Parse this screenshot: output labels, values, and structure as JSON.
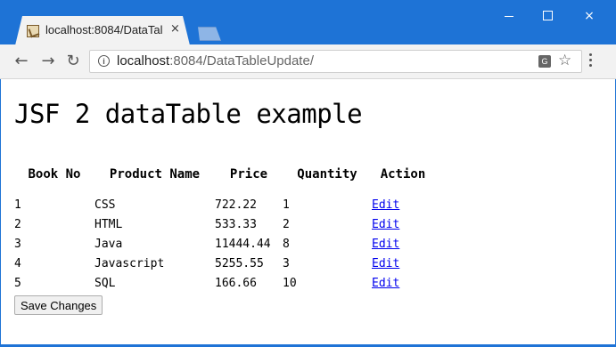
{
  "browser": {
    "tab_title": "localhost:8084/DataTal",
    "url_host": "localhost",
    "url_rest": ":8084/DataTableUpdate/",
    "close_glyph": "×",
    "back_glyph": "←",
    "forward_glyph": "→",
    "reload_glyph": "↻",
    "star_glyph": "☆",
    "info_glyph": "i",
    "translate_glyph": "G"
  },
  "page": {
    "heading": "JSF 2 dataTable example",
    "table": {
      "columns": [
        "Book No",
        "Product Name",
        "Price",
        "Quantity",
        "Action"
      ],
      "rows": [
        {
          "no": "1",
          "name": "CSS",
          "price": "722.22",
          "qty": "1",
          "action": "Edit"
        },
        {
          "no": "2",
          "name": "HTML",
          "price": "533.33",
          "qty": "2",
          "action": "Edit"
        },
        {
          "no": "3",
          "name": "Java",
          "price": "11444.44",
          "qty": "8",
          "action": "Edit"
        },
        {
          "no": "4",
          "name": "Javascript",
          "price": "5255.55",
          "qty": "3",
          "action": "Edit"
        },
        {
          "no": "5",
          "name": "SQL",
          "price": "166.66",
          "qty": "10",
          "action": "Edit"
        }
      ]
    },
    "save_button": "Save Changes"
  },
  "colors": {
    "chrome_frame": "#1e73d6",
    "tab_bg": "#f2f2f2",
    "link": "#0000ee"
  }
}
